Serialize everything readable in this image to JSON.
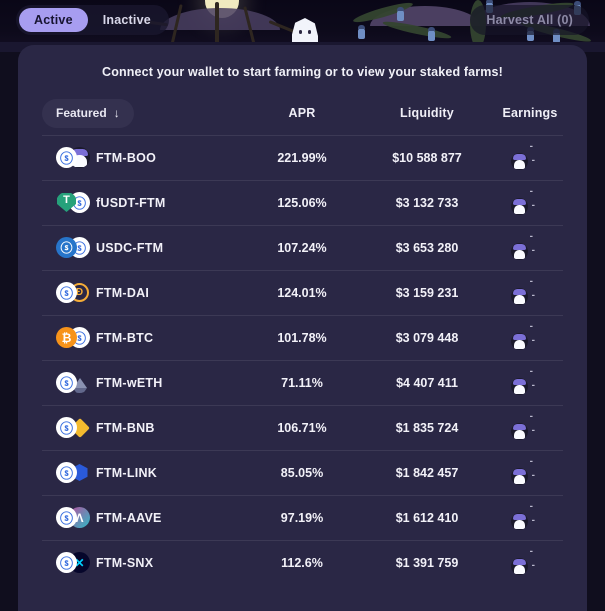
{
  "topbar": {
    "tabs": [
      {
        "label": "Active",
        "active": true
      },
      {
        "label": "Inactive",
        "active": false
      }
    ],
    "harvest_all_label": "Harvest All (0)"
  },
  "card": {
    "connect_message": "Connect your wallet to start farming or to view your staked farms!"
  },
  "table": {
    "sort_pill": {
      "label": "Featured",
      "arrow": "↓"
    },
    "headers": {
      "name": "Featured",
      "apr": "APR",
      "liquidity": "Liquidity",
      "earnings": "Earnings"
    },
    "rows": [
      {
        "pair": "FTM-BOO",
        "tokens": [
          "ftm",
          "boo"
        ],
        "apr": "221.99%",
        "liquidity": "$10 588 877",
        "earn_usd": "-",
        "earn_amount": "-"
      },
      {
        "pair": "fUSDT-FTM",
        "tokens": [
          "usdt",
          "ftm"
        ],
        "apr": "125.06%",
        "liquidity": "$3 132 733",
        "earn_usd": "-",
        "earn_amount": "-"
      },
      {
        "pair": "USDC-FTM",
        "tokens": [
          "usdc",
          "ftm"
        ],
        "apr": "107.24%",
        "liquidity": "$3 653 280",
        "earn_usd": "-",
        "earn_amount": "-"
      },
      {
        "pair": "FTM-DAI",
        "tokens": [
          "ftm",
          "dai"
        ],
        "apr": "124.01%",
        "liquidity": "$3 159 231",
        "earn_usd": "-",
        "earn_amount": "-"
      },
      {
        "pair": "FTM-BTC",
        "tokens": [
          "btc",
          "ftm"
        ],
        "apr": "101.78%",
        "liquidity": "$3 079 448",
        "earn_usd": "-",
        "earn_amount": "-"
      },
      {
        "pair": "FTM-wETH",
        "tokens": [
          "ftm",
          "eth"
        ],
        "apr": "71.11%",
        "liquidity": "$4 407 411",
        "earn_usd": "-",
        "earn_amount": "-"
      },
      {
        "pair": "FTM-BNB",
        "tokens": [
          "ftm",
          "bnb"
        ],
        "apr": "106.71%",
        "liquidity": "$1 835 724",
        "earn_usd": "-",
        "earn_amount": "-"
      },
      {
        "pair": "FTM-LINK",
        "tokens": [
          "ftm",
          "link"
        ],
        "apr": "85.05%",
        "liquidity": "$1 842 457",
        "earn_usd": "-",
        "earn_amount": "-"
      },
      {
        "pair": "FTM-AAVE",
        "tokens": [
          "ftm",
          "aave"
        ],
        "apr": "97.19%",
        "liquidity": "$1 612 410",
        "earn_usd": "-",
        "earn_amount": "-"
      },
      {
        "pair": "FTM-SNX",
        "tokens": [
          "ftm",
          "snx"
        ],
        "apr": "112.6%",
        "liquidity": "$1 391 759",
        "earn_usd": "-",
        "earn_amount": "-"
      }
    ]
  },
  "colors": {
    "page_background": "#100e1e",
    "card_background": "#2a2745",
    "accent_active_tab": "#a79df0",
    "text_primary": "#f2f1f8",
    "text_muted": "#b9b7cc",
    "row_divider": "rgba(255,255,255,0.085)"
  }
}
